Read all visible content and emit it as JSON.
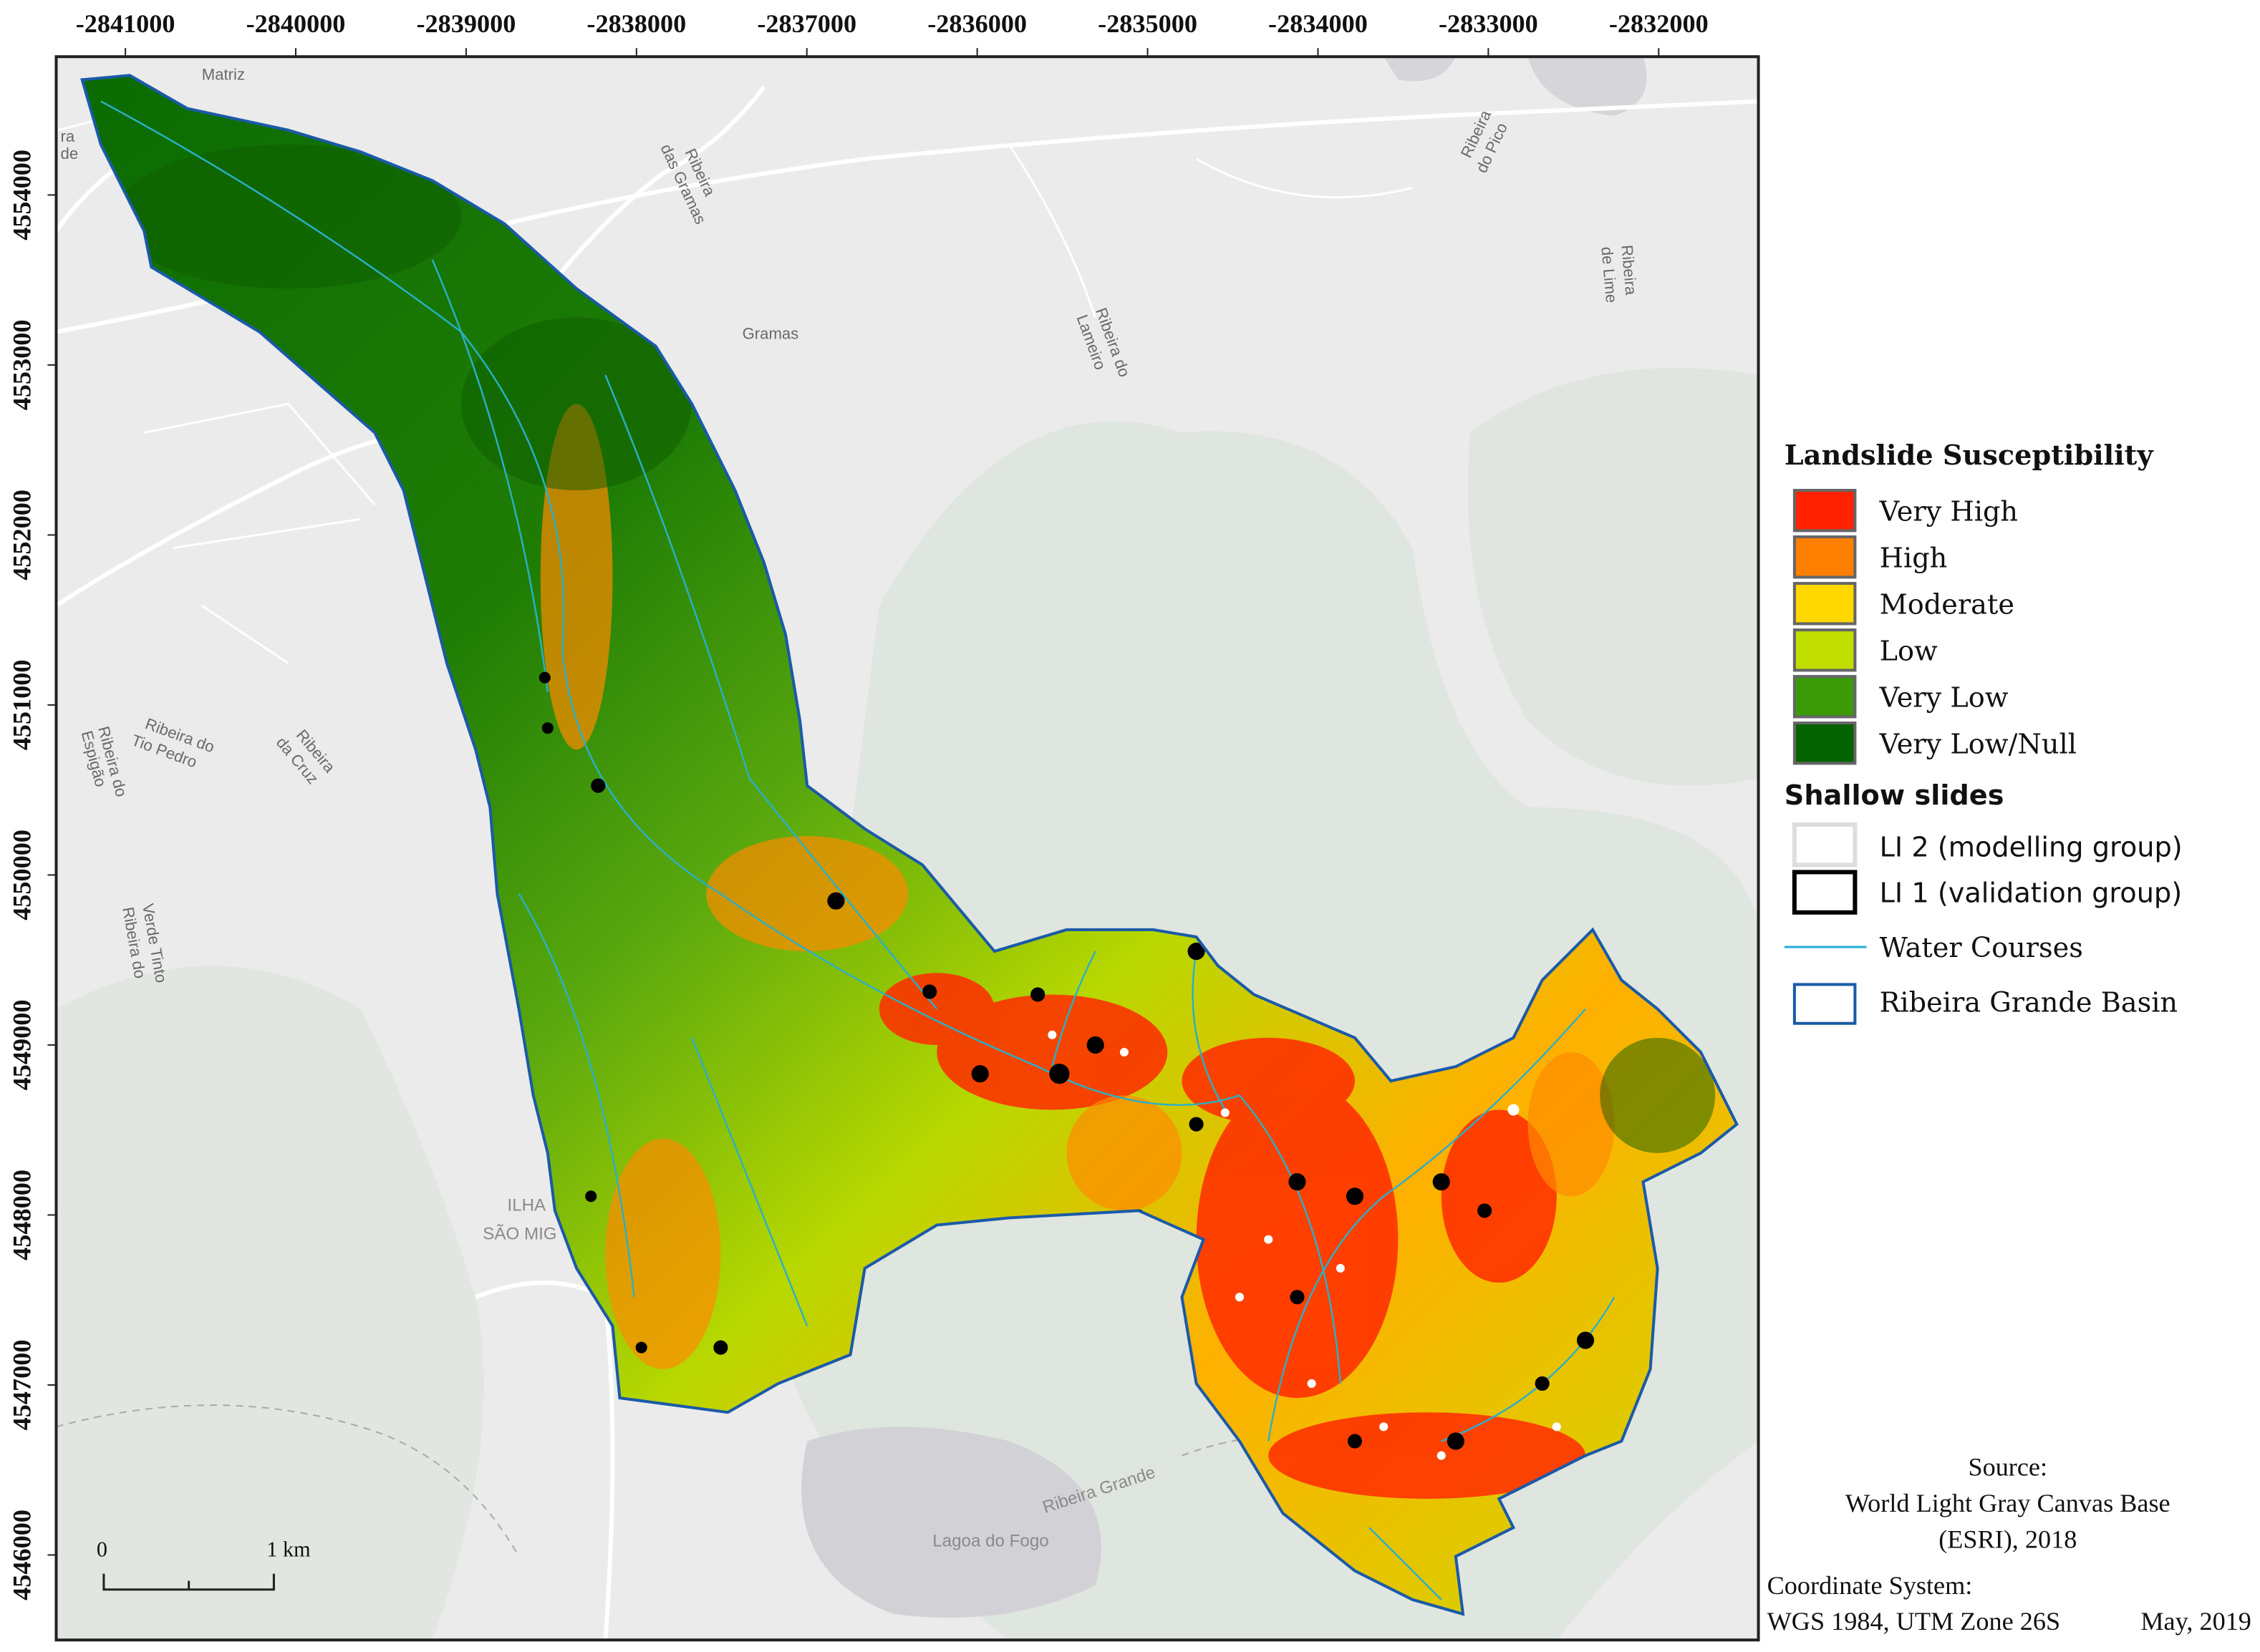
{
  "map": {
    "x_ticks": [
      "-2841000",
      "-2840000",
      "-2839000",
      "-2838000",
      "-2837000",
      "-2836000",
      "-2835000",
      "-2834000",
      "-2833000",
      "-2832000"
    ],
    "y_ticks": [
      "4554000",
      "4553000",
      "4552000",
      "4551000",
      "4550000",
      "4549000",
      "4548000",
      "4547000",
      "4546000"
    ],
    "places": {
      "matriz": "Matriz",
      "gramas": "Gramas",
      "ribeira_das_gramas_1": "Ribeira",
      "ribeira_das_gramas_2": "das Gramas",
      "ribeira_do_pico_1": "Ribeira",
      "ribeira_do_pico_2": "do Pico",
      "ribeira_de_lime_1": "Ribeira",
      "ribeira_de_lime_2": "de Lime",
      "ribeira_do_lameiro_1": "Ribeira do",
      "ribeira_do_lameiro_2": "Lameiro",
      "ribeira_tio_pedro_1": "Ribeira do",
      "ribeira_tio_pedro_2": "Tio Pedro",
      "ribeira_da_cruz_1": "Ribeira",
      "ribeira_da_cruz_2": "da Cruz",
      "ribeira_espigao_1": "Ribeira do",
      "ribeira_espigao_2": "Espigão",
      "ribeira_verde_1": "Ribeira do",
      "ribeira_verde_2": "Verde Tinto",
      "ilha_1": "ILHA",
      "ilha_2": "SÃO MIG",
      "ribeira_grande": "Ribeira Grande",
      "lagoa_do_fogo": "Lagoa do Fogo",
      "edge_1": "ra",
      "edge_2": "de"
    },
    "scale_bar": {
      "start": "0",
      "end": "1 km"
    }
  },
  "legend": {
    "susceptibility_title": "Landslide Susceptibility",
    "classes": [
      {
        "label": "Very High",
        "color": "#ff2200"
      },
      {
        "label": "High",
        "color": "#ff8000"
      },
      {
        "label": "Moderate",
        "color": "#ffd800"
      },
      {
        "label": "Low",
        "color": "#c0de00"
      },
      {
        "label": "Very Low",
        "color": "#3a9a08"
      },
      {
        "label": "Very Low/Null",
        "color": "#056200"
      }
    ],
    "slides_title": "Shallow slides",
    "slides": [
      {
        "label": "LI 2 (modelling group)"
      },
      {
        "label": "LI 1 (validation group)"
      }
    ],
    "water_courses": "Water Courses",
    "basin": "Ribeira Grande Basin"
  },
  "notes": {
    "source_label": "Source:",
    "source_line1": "World Light Gray Canvas Base",
    "source_line2": "(ESRI), 2018",
    "coord_label": "Coordinate System:",
    "coord_value": "WGS 1984, UTM Zone 26S",
    "date": "May, 2019"
  }
}
